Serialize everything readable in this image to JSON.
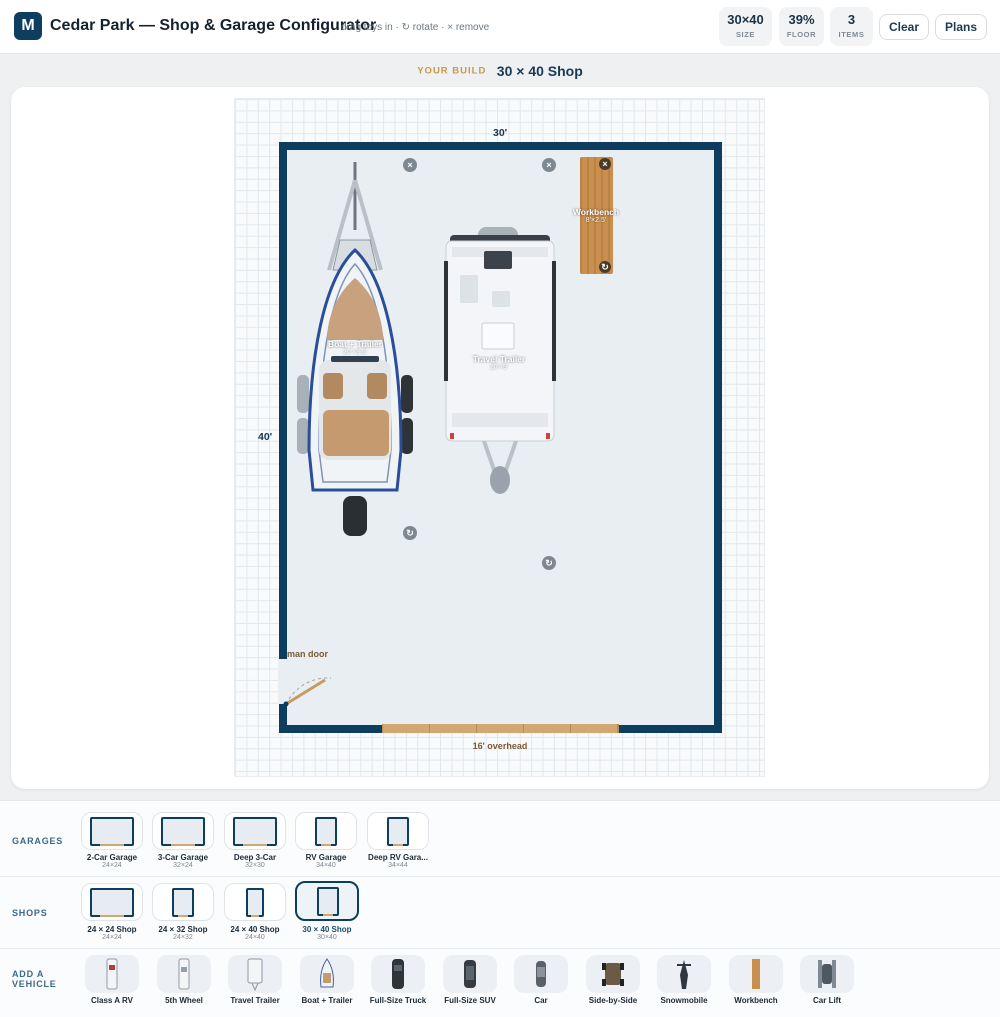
{
  "header": {
    "logo": "M",
    "title": "Cedar Park — Shop & Garage Configurator",
    "hint": "drag toys in · ↻ rotate · × remove",
    "stats": [
      {
        "value": "30×40",
        "label": "SIZE"
      },
      {
        "value": "39%",
        "label": "FLOOR"
      },
      {
        "value": "3",
        "label": "ITEMS"
      }
    ],
    "clear_label": "Clear",
    "plans_label": "Plans"
  },
  "build": {
    "label": "YOUR BUILD",
    "name": "30 × 40 Shop"
  },
  "plan": {
    "width_label": "30'",
    "depth_label": "40'",
    "man_door_label": "man door",
    "overhead_label": "16' overhead",
    "items": [
      {
        "name": "Boat + Trailer",
        "size": "20'×8.5'"
      },
      {
        "name": "Travel Trailer",
        "size": "20'×9'"
      },
      {
        "name": "Workbench",
        "size": "8'×2.5'"
      }
    ],
    "remove_glyph": "×",
    "rotate_glyph": "↻"
  },
  "tray": {
    "garages_label": "GARAGES",
    "shops_label": "SHOPS",
    "vehicles_label_1": "ADD A",
    "vehicles_label_2": "VEHICLE",
    "garages": [
      {
        "name": "2-Car Garage",
        "size": "24×24"
      },
      {
        "name": "3-Car Garage",
        "size": "32×24"
      },
      {
        "name": "Deep 3-Car",
        "size": "32×30"
      },
      {
        "name": "RV Garage",
        "size": "34×40"
      },
      {
        "name": "Deep RV Gara...",
        "size": "34×44"
      }
    ],
    "shops": [
      {
        "name": "24 × 24 Shop",
        "size": "24×24"
      },
      {
        "name": "24 × 32 Shop",
        "size": "24×32"
      },
      {
        "name": "24 × 40 Shop",
        "size": "24×40"
      },
      {
        "name": "30 × 40 Shop",
        "size": "30×40",
        "selected": true
      }
    ],
    "vehicles": [
      {
        "name": "Class A RV",
        "icon": "class-a-rv-icon"
      },
      {
        "name": "5th Wheel",
        "icon": "fifth-wheel-icon"
      },
      {
        "name": "Travel Trailer",
        "icon": "travel-trailer-icon"
      },
      {
        "name": "Boat + Trailer",
        "icon": "boat-icon"
      },
      {
        "name": "Full-Size Truck",
        "icon": "truck-icon"
      },
      {
        "name": "Full-Size SUV",
        "icon": "suv-icon"
      },
      {
        "name": "Car",
        "icon": "car-icon"
      },
      {
        "name": "Side-by-Side",
        "icon": "side-by-side-icon"
      },
      {
        "name": "Snowmobile",
        "icon": "snowmobile-icon"
      },
      {
        "name": "Workbench",
        "icon": "workbench-icon"
      },
      {
        "name": "Car Lift",
        "icon": "car-lift-icon"
      }
    ]
  },
  "colors": {
    "brand": "#0e3e5f",
    "accent": "#c89a48",
    "wood": "#d4a770"
  }
}
